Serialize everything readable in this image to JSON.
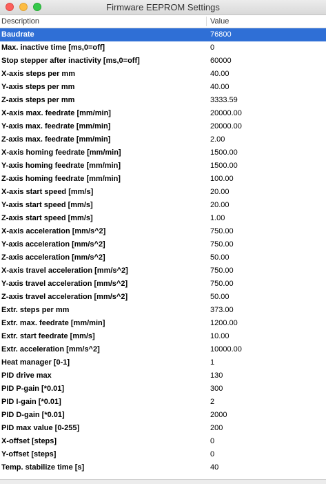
{
  "window": {
    "title": "Firmware EEPROM Settings"
  },
  "table": {
    "columns": [
      "Description",
      "Value"
    ],
    "selected_index": 0,
    "rows": [
      {
        "description": "Baudrate",
        "value": "76800"
      },
      {
        "description": "Max. inactive time [ms,0=off]",
        "value": "0"
      },
      {
        "description": "Stop stepper after inactivity [ms,0=off]",
        "value": "60000"
      },
      {
        "description": "X-axis steps per mm",
        "value": "40.00"
      },
      {
        "description": "Y-axis steps per mm",
        "value": "40.00"
      },
      {
        "description": "Z-axis steps per mm",
        "value": "3333.59"
      },
      {
        "description": "X-axis max. feedrate [mm/min]",
        "value": "20000.00"
      },
      {
        "description": "Y-axis max. feedrate [mm/min]",
        "value": "20000.00"
      },
      {
        "description": "Z-axis max. feedrate [mm/min]",
        "value": "2.00"
      },
      {
        "description": "X-axis homing feedrate [mm/min]",
        "value": "1500.00"
      },
      {
        "description": "Y-axis homing feedrate [mm/min]",
        "value": "1500.00"
      },
      {
        "description": "Z-axis homing feedrate [mm/min]",
        "value": "100.00"
      },
      {
        "description": "X-axis start speed [mm/s]",
        "value": "20.00"
      },
      {
        "description": "Y-axis start speed [mm/s]",
        "value": "20.00"
      },
      {
        "description": "Z-axis start speed [mm/s]",
        "value": "1.00"
      },
      {
        "description": "X-axis acceleration [mm/s^2]",
        "value": "750.00"
      },
      {
        "description": "Y-axis acceleration [mm/s^2]",
        "value": "750.00"
      },
      {
        "description": "Z-axis acceleration [mm/s^2]",
        "value": "50.00"
      },
      {
        "description": "X-axis travel acceleration [mm/s^2]",
        "value": "750.00"
      },
      {
        "description": "Y-axis travel acceleration [mm/s^2]",
        "value": "750.00"
      },
      {
        "description": "Z-axis travel acceleration [mm/s^2]",
        "value": "50.00"
      },
      {
        "description": "Extr. steps per mm",
        "value": "373.00"
      },
      {
        "description": "Extr. max. feedrate [mm/min]",
        "value": "1200.00"
      },
      {
        "description": "Extr. start feedrate [mm/s]",
        "value": "10.00"
      },
      {
        "description": "Extr. acceleration [mm/s^2]",
        "value": "10000.00"
      },
      {
        "description": "Heat manager [0-1]",
        "value": "1"
      },
      {
        "description": "PID drive max",
        "value": "130"
      },
      {
        "description": "PID P-gain [*0.01]",
        "value": "300"
      },
      {
        "description": "PID I-gain [*0.01]",
        "value": "2"
      },
      {
        "description": "PID D-gain [*0.01]",
        "value": "2000"
      },
      {
        "description": "PID max value [0-255]",
        "value": "200"
      },
      {
        "description": "X-offset [steps]",
        "value": "0"
      },
      {
        "description": "Y-offset [steps]",
        "value": "0"
      },
      {
        "description": "Temp. stabilize time [s]",
        "value": "40"
      }
    ]
  }
}
